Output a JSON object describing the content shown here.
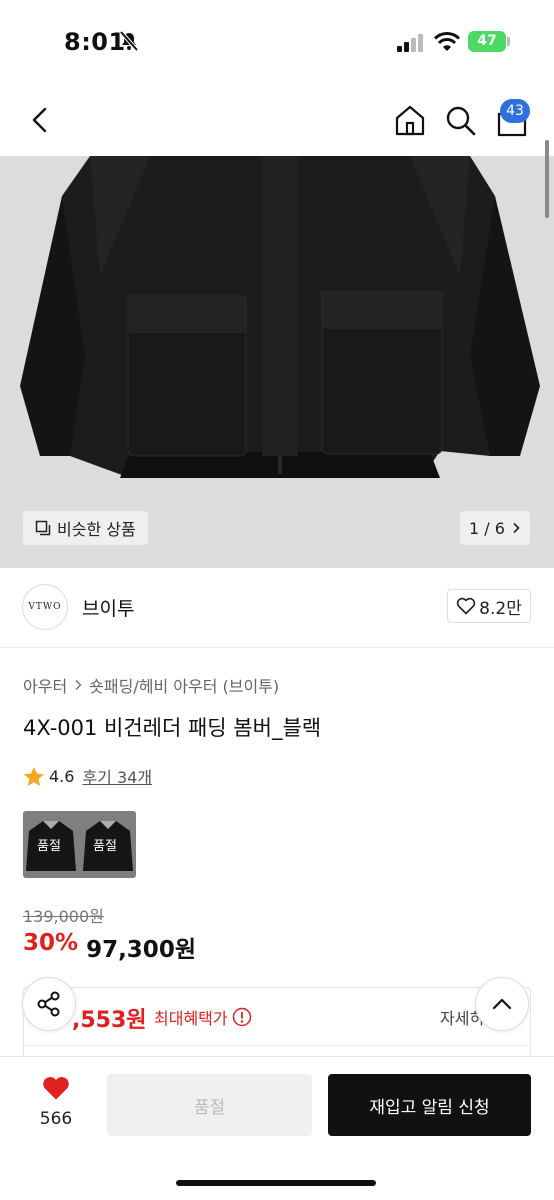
{
  "status": {
    "time": "8:01",
    "battery": "47"
  },
  "nav": {
    "cart_count": "43"
  },
  "image": {
    "similar_label": "비슷한 상품",
    "page_indicator": "1 / 6"
  },
  "brand": {
    "logo_text": "VTWO",
    "name": "브이투",
    "like_count": "8.2만"
  },
  "product": {
    "breadcrumb": [
      "아우터",
      "숏패딩/헤비 아우터 (브이투)"
    ],
    "title": "4X-001 비건레더 패딩 봄버_블랙",
    "rating": "4.6",
    "review_text": "후기 34개",
    "color_options": [
      {
        "status": "품절"
      },
      {
        "status": "품절"
      }
    ],
    "original_price": "139,000원",
    "discount_rate": "30%",
    "sale_price": "97,300원"
  },
  "benefit": {
    "price": ",553원",
    "label": "최대혜택가",
    "detail": "자세히"
  },
  "bottom": {
    "wish_count": "566",
    "soldout_label": "품절",
    "restock_label": "재입고 알림 신청"
  },
  "colors": {
    "accent_red": "#e1201e",
    "badge_blue": "#2f6fe0",
    "primary_black": "#111111"
  }
}
